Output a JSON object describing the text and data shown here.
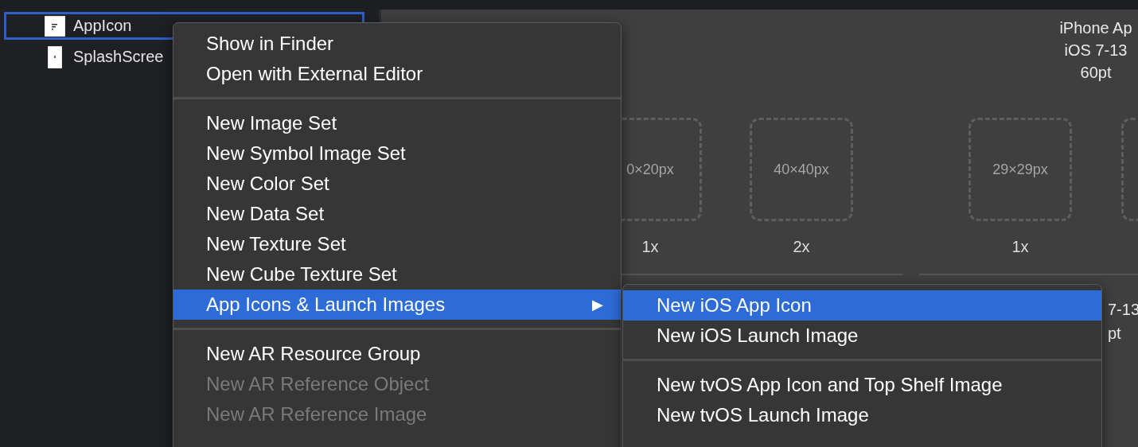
{
  "sidebar": {
    "items": [
      {
        "label": "AppIcon",
        "kind": "appicon",
        "selected": true
      },
      {
        "label": "SplashScree",
        "kind": "image",
        "selected": false
      }
    ]
  },
  "canvas": {
    "groups": [
      {
        "slots": [
          {
            "kind": "labeled",
            "size": "0×20px",
            "scale": "1x"
          },
          {
            "kind": "labeled",
            "size": "40×40px",
            "scale": "2x"
          }
        ]
      },
      {
        "header": [
          "iPhone Ap",
          "iOS 7-13",
          "60pt"
        ],
        "slots": [
          {
            "kind": "labeled",
            "size": "29×29px",
            "scale": "1x"
          },
          {
            "kind": "blank"
          }
        ]
      }
    ],
    "second_row_fragments": [
      "7-13",
      "pt"
    ]
  },
  "context_menu": {
    "sections": [
      [
        {
          "label": "Show in Finder",
          "disabled": false,
          "selected": false
        },
        {
          "label": "Open with External Editor",
          "disabled": false,
          "selected": false
        }
      ],
      [
        {
          "label": "New Image Set",
          "disabled": false,
          "selected": false
        },
        {
          "label": "New Symbol Image Set",
          "disabled": false,
          "selected": false
        },
        {
          "label": "New Color Set",
          "disabled": false,
          "selected": false
        },
        {
          "label": "New Data Set",
          "disabled": false,
          "selected": false
        },
        {
          "label": "New Texture Set",
          "disabled": false,
          "selected": false
        },
        {
          "label": "New Cube Texture Set",
          "disabled": false,
          "selected": false
        },
        {
          "label": "App Icons & Launch Images",
          "disabled": false,
          "selected": true,
          "arrow": "▶"
        }
      ],
      [
        {
          "label": "New AR Resource Group",
          "disabled": false,
          "selected": false
        },
        {
          "label": "New AR Reference Object",
          "disabled": true,
          "selected": false
        },
        {
          "label": "New AR Reference Image",
          "disabled": true,
          "selected": false
        }
      ]
    ]
  },
  "submenu": {
    "sections": [
      [
        {
          "label": "New iOS App Icon",
          "disabled": false,
          "selected": true
        },
        {
          "label": "New iOS Launch Image",
          "disabled": false,
          "selected": false
        }
      ],
      [
        {
          "label": "New tvOS App Icon and Top Shelf Image",
          "disabled": false,
          "selected": false
        },
        {
          "label": "New tvOS Launch Image",
          "disabled": false,
          "selected": false
        }
      ]
    ]
  }
}
